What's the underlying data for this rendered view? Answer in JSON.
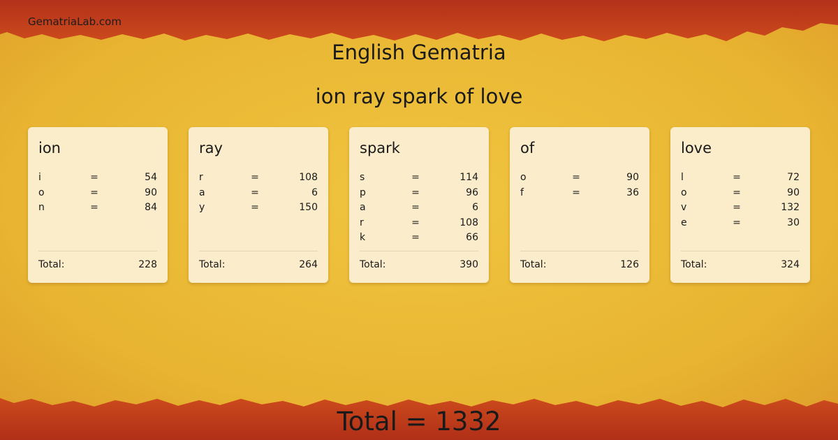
{
  "site": {
    "name": "GematriaLab.com"
  },
  "title": "English Gematria",
  "phrase": "ion ray spark of love",
  "total_label": "Total:",
  "equals_sign": "=",
  "words": [
    {
      "word": "ion",
      "letters": [
        {
          "ch": "i",
          "val": "54"
        },
        {
          "ch": "o",
          "val": "90"
        },
        {
          "ch": "n",
          "val": "84"
        }
      ],
      "total": "228"
    },
    {
      "word": "ray",
      "letters": [
        {
          "ch": "r",
          "val": "108"
        },
        {
          "ch": "a",
          "val": "6"
        },
        {
          "ch": "y",
          "val": "150"
        }
      ],
      "total": "264"
    },
    {
      "word": "spark",
      "letters": [
        {
          "ch": "s",
          "val": "114"
        },
        {
          "ch": "p",
          "val": "96"
        },
        {
          "ch": "a",
          "val": "6"
        },
        {
          "ch": "r",
          "val": "108"
        },
        {
          "ch": "k",
          "val": "66"
        }
      ],
      "total": "390"
    },
    {
      "word": "of",
      "letters": [
        {
          "ch": "o",
          "val": "90"
        },
        {
          "ch": "f",
          "val": "36"
        }
      ],
      "total": "126"
    },
    {
      "word": "love",
      "letters": [
        {
          "ch": "l",
          "val": "72"
        },
        {
          "ch": "o",
          "val": "90"
        },
        {
          "ch": "v",
          "val": "132"
        },
        {
          "ch": "e",
          "val": "30"
        }
      ],
      "total": "324"
    }
  ],
  "grand_total": "Total = 1332",
  "colors": {
    "parchment": "#e9b635",
    "torn_edge": "#c1391a",
    "card": "#fcf0d6",
    "text": "#1a1a1a"
  }
}
